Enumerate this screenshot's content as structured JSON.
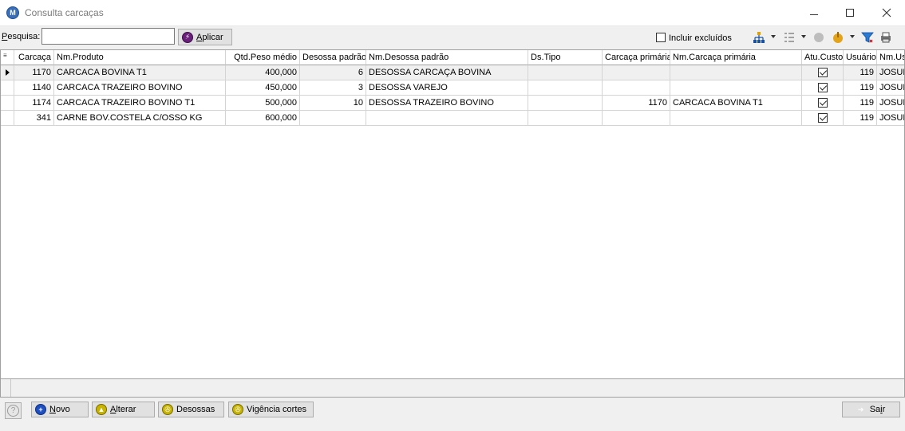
{
  "window": {
    "title": "Consulta carcaças",
    "app_icon_glyph": "M"
  },
  "toolbar": {
    "search_label_prefix": "P",
    "search_label_rest": "esquisa:",
    "search_value": "",
    "apply_label_prefix": "A",
    "apply_label_rest": "plicar",
    "include_deleted_label": "Incluir excluídos",
    "include_deleted_checked": false,
    "icons": [
      "hierarchy-icon",
      "list-tree-icon",
      "record-icon",
      "hand-pointer-icon",
      "filter-icon",
      "printer-icon"
    ]
  },
  "grid": {
    "columns": [
      {
        "key": "carcaca",
        "label": "Carcaça"
      },
      {
        "key": "nmprod",
        "label": "Nm.Produto"
      },
      {
        "key": "qtd",
        "label": "Qtd.Peso médio"
      },
      {
        "key": "desossa",
        "label": "Desossa padrão"
      },
      {
        "key": "nmdesossa",
        "label": "Nm.Desossa padrão"
      },
      {
        "key": "dstipo",
        "label": "Ds.Tipo"
      },
      {
        "key": "carcprim",
        "label": "Carcaça primária"
      },
      {
        "key": "nmcarcprim",
        "label": "Nm.Carcaça primária"
      },
      {
        "key": "atu",
        "label": "Atu.Custo"
      },
      {
        "key": "usuario",
        "label": "Usuário"
      },
      {
        "key": "nmus",
        "label": "Nm.Us"
      }
    ],
    "rows": [
      {
        "carcaca": "1170",
        "nmprod": "CARCACA BOVINA T1",
        "qtd": "400,000",
        "desossa": "6",
        "nmdesossa": "DESOSSA CARCAÇA BOVINA",
        "dstipo": "",
        "carcprim": "",
        "nmcarcprim": "",
        "atu": true,
        "usuario": "119",
        "nmus": "JOSUE",
        "selected": true
      },
      {
        "carcaca": "1140",
        "nmprod": "CARCACA TRAZEIRO BOVINO",
        "qtd": "450,000",
        "desossa": "3",
        "nmdesossa": "DESOSSA VAREJO",
        "dstipo": "",
        "carcprim": "",
        "nmcarcprim": "",
        "atu": true,
        "usuario": "119",
        "nmus": "JOSUE",
        "selected": false
      },
      {
        "carcaca": "1174",
        "nmprod": "CARCACA TRAZEIRO BOVINO T1",
        "qtd": "500,000",
        "desossa": "10",
        "nmdesossa": "DESOSSA TRAZEIRO BOVINO",
        "dstipo": "",
        "carcprim": "1170",
        "nmcarcprim": "CARCACA BOVINA T1",
        "atu": true,
        "usuario": "119",
        "nmus": "JOSUE",
        "selected": false
      },
      {
        "carcaca": "341",
        "nmprod": "CARNE BOV.COSTELA C/OSSO KG",
        "qtd": "600,000",
        "desossa": "",
        "nmdesossa": "",
        "dstipo": "",
        "carcprim": "",
        "nmcarcprim": "",
        "atu": true,
        "usuario": "119",
        "nmus": "JOSUE",
        "selected": false
      }
    ]
  },
  "footer": {
    "help_glyph": "?",
    "novo_prefix": "N",
    "novo_rest": "ovo",
    "alterar_prefix": "A",
    "alterar_rest": "lterar",
    "desossas_label": "Desossas",
    "vigencia_label": "Vigência cortes",
    "sair_prefix": "Sa",
    "sair_underline": "i",
    "sair_rest": "r"
  }
}
